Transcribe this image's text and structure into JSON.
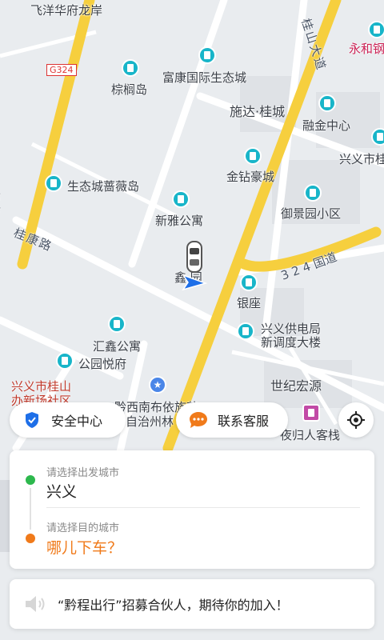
{
  "map": {
    "labels": [
      {
        "id": "feiyang",
        "text": "飞洋华府龙岸"
      },
      {
        "id": "g324",
        "text": "G324"
      },
      {
        "id": "zonglvdao",
        "text": "棕榈岛"
      },
      {
        "id": "fukang",
        "text": "富康国际生态城"
      },
      {
        "id": "guishan-road",
        "text": "桂山大道"
      },
      {
        "id": "yonghe",
        "text": "永和钢"
      },
      {
        "id": "shida",
        "text": "施达·桂城"
      },
      {
        "id": "rongjin",
        "text": "融金中心"
      },
      {
        "id": "xingyi-city",
        "text": "兴义市桂"
      },
      {
        "id": "shengtaicheng",
        "text": "生态城蔷薇岛"
      },
      {
        "id": "jinzuan",
        "text": "金钻豪城"
      },
      {
        "id": "yujingyuan",
        "text": "御景园小区"
      },
      {
        "id": "xinya",
        "text": "新雅公寓"
      },
      {
        "id": "guikang-road",
        "text": "桂康路"
      },
      {
        "id": "guodao324",
        "text": "3 2 4 国道"
      },
      {
        "id": "xinyuan",
        "text": "鑫 园"
      },
      {
        "id": "yinzuo",
        "text": "银座"
      },
      {
        "id": "gongdianju",
        "text": "兴义供电局"
      },
      {
        "id": "xindiaodu",
        "text": "新调度大楼"
      },
      {
        "id": "huixin",
        "text": "汇鑫公寓"
      },
      {
        "id": "gongyuanyue",
        "text": "公园悦府"
      },
      {
        "id": "shijihongyuan",
        "text": "世纪宏源"
      },
      {
        "id": "guishan-community",
        "text": "兴义市桂山"
      },
      {
        "id": "xinchang-community",
        "text": "办新场社区"
      },
      {
        "id": "qianxinan",
        "text": "黔西南布依族苗"
      },
      {
        "id": "zizhizhou",
        "text": "自治州林"
      },
      {
        "id": "yeguiren",
        "text": "夜归人客栈"
      },
      {
        "id": "xing-left",
        "text": "兴义"
      }
    ]
  },
  "buttons": {
    "safety_center": "安全中心",
    "contact_service": "联系客服"
  },
  "trip": {
    "from_hint": "请选择出发城市",
    "from_value": "兴义",
    "to_hint": "请选择目的城市",
    "to_value": "哪儿下车？"
  },
  "notice": {
    "text": "“黔程出行”招募合伙人，期待你的加入！"
  },
  "colors": {
    "green_dot": "#2db84d",
    "orange_dot": "#f07a1a",
    "accent_orange": "#f07a1a",
    "shield_blue": "#1e6fe8",
    "road_yellow": "#f6cf3e",
    "poi_teal": "#18b5c9"
  }
}
